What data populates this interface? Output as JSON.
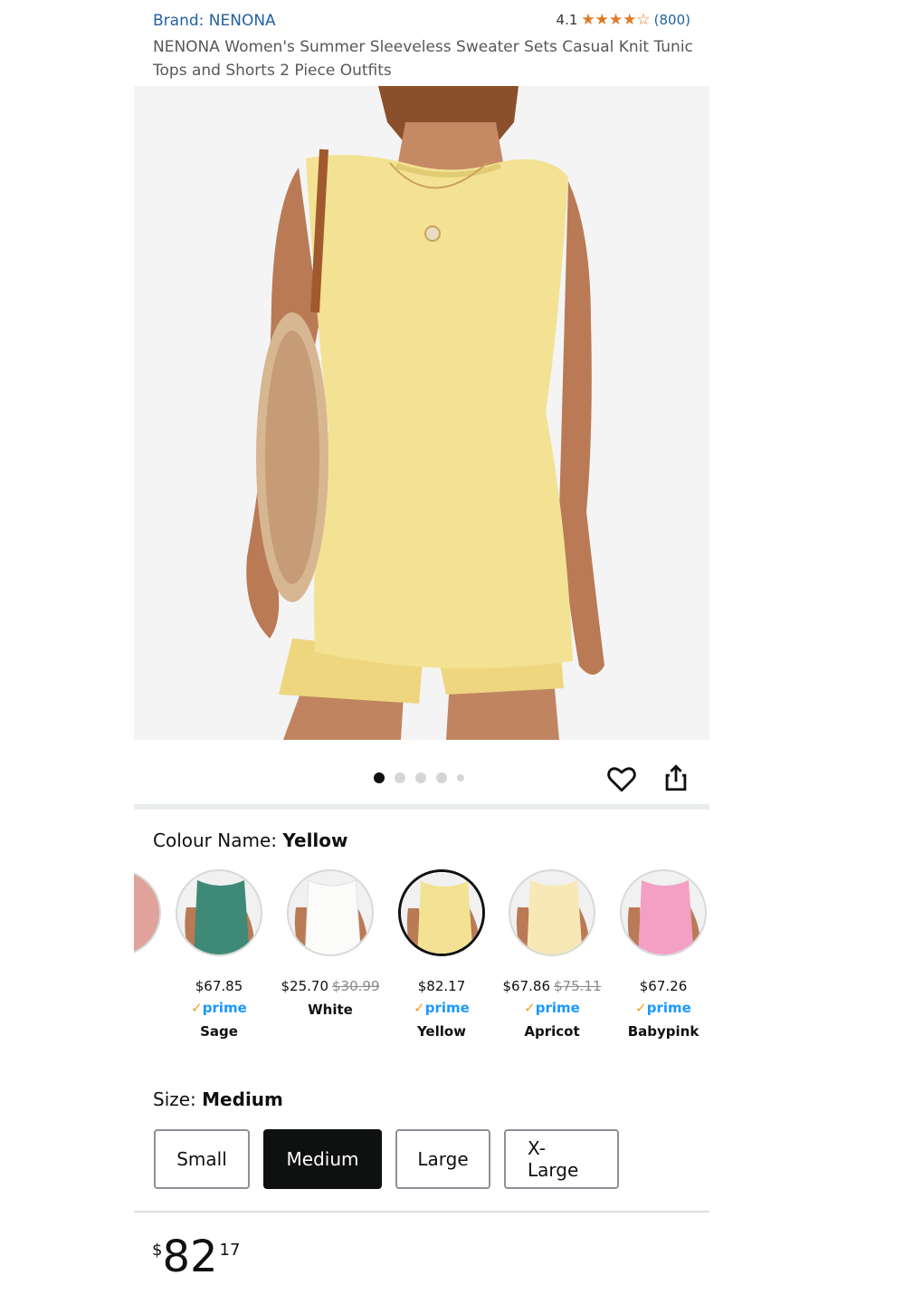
{
  "header": {
    "brand": "Brand: NENONA",
    "rating_value": "4.1",
    "rating_stars": 4.1,
    "rating_count": "(800)",
    "title": "NENONA Women's Summer Sleeveless Sweater Sets Casual Knit Tunic Tops and Shorts 2 Piece Outfits"
  },
  "gallery": {
    "total_images": 5,
    "active_index": 0
  },
  "colour": {
    "label": "Colour Name:",
    "selected": "Yellow",
    "options": [
      {
        "name": "Sage",
        "price": "$67.85",
        "list_price": "",
        "prime": "prime",
        "hex": "#3f8a76"
      },
      {
        "name": "White",
        "price": "$25.70",
        "list_price": "$30.99",
        "prime": "",
        "hex": "#f3f3f1"
      },
      {
        "name": "Yellow",
        "price": "$82.17",
        "list_price": "",
        "prime": "prime",
        "hex": "#f3e293"
      },
      {
        "name": "Apricot",
        "price": "$67.86",
        "list_price": "$75.11",
        "prime": "prime",
        "hex": "#f8e8b6"
      },
      {
        "name": "Babypink",
        "price": "$67.26",
        "list_price": "",
        "prime": "prime",
        "hex": "#f4a0c4"
      }
    ]
  },
  "size": {
    "label": "Size:",
    "selected": "Medium",
    "options": [
      "Small",
      "Medium",
      "Large",
      "X-Large"
    ]
  },
  "price": {
    "currency": "$",
    "whole": "82",
    "fraction": "17"
  },
  "colors": {
    "link": "#2162a1",
    "star": "#de7921",
    "prime_blue": "#1a98ff",
    "prime_check": "#f29e1d"
  }
}
